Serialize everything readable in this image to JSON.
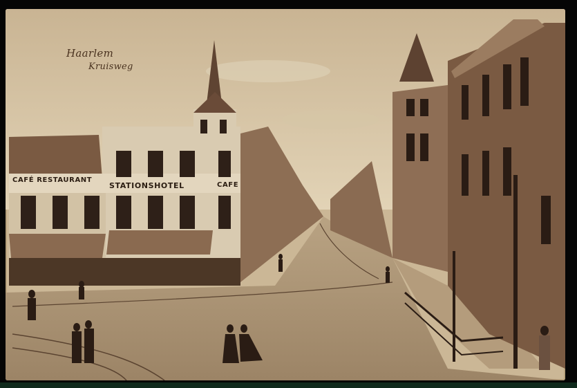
{
  "photo": {
    "caption_city": "Haarlem",
    "caption_street": "Kruisweg",
    "signs": {
      "cafe_restaurant": "CAFÉ RESTAURANT",
      "stationshotel": "STATIONSHOTEL",
      "cafe": "CAFE"
    },
    "colors": {
      "sky": "#d8c7a8",
      "paper": "#cbb796",
      "building_light": "#d9cbb1",
      "building_dark": "#7a5a42",
      "street": "#a99173",
      "ink": "#3b2818"
    }
  }
}
